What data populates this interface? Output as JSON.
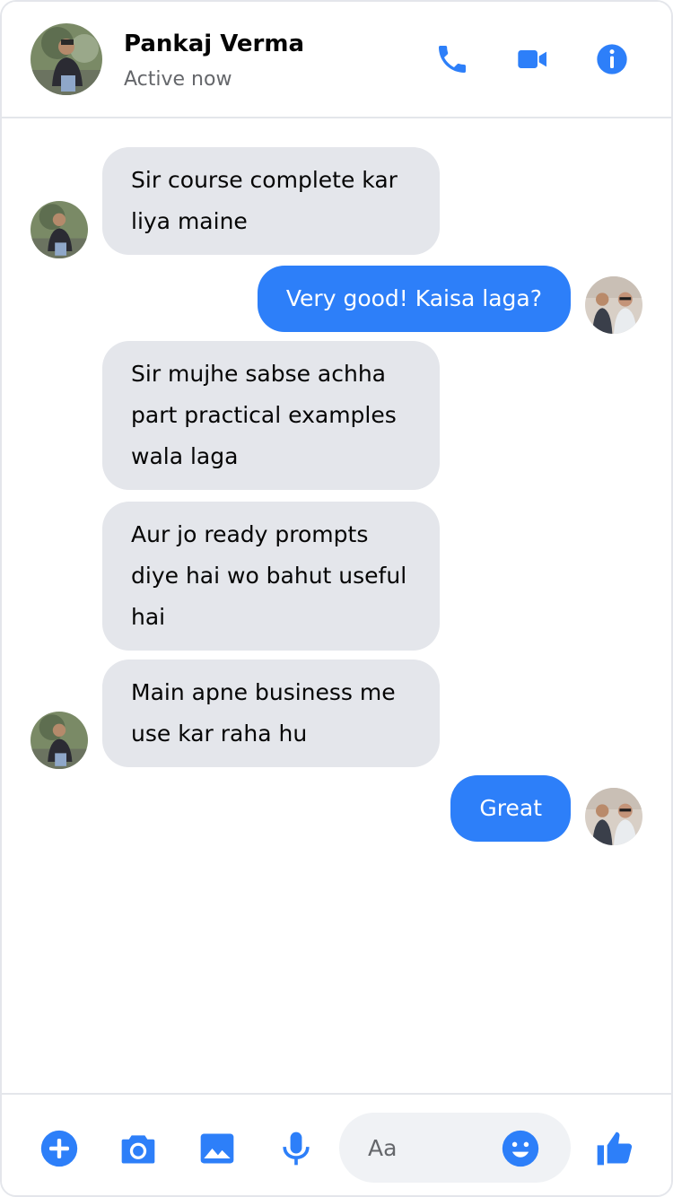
{
  "header": {
    "contact_name": "Pankaj Verma",
    "status": "Active now",
    "icons": [
      "phone-icon",
      "video-camera-icon",
      "info-icon"
    ]
  },
  "messages": [
    {
      "sender": "contact",
      "text": "Sir course complete kar liya maine"
    },
    {
      "sender": "self",
      "text": "Very good! Kaisa laga?"
    },
    {
      "sender": "contact",
      "text": "Sir mujhe sabse achha part practical examples wala laga"
    },
    {
      "sender": "contact",
      "text": "Aur jo ready prompts diye hai wo bahut useful hai"
    },
    {
      "sender": "contact",
      "text": "Main apne business me use kar raha hu"
    },
    {
      "sender": "self",
      "text": "Great"
    }
  ],
  "composer": {
    "placeholder": "Aa",
    "icons": [
      "plus-icon",
      "camera-icon",
      "image-icon",
      "microphone-icon",
      "emoji-icon",
      "thumbs-up-icon"
    ]
  },
  "colors": {
    "accent": "#2d7ff9",
    "incoming_bubble": "#e4e6eb",
    "secondary_text": "#65676b"
  }
}
